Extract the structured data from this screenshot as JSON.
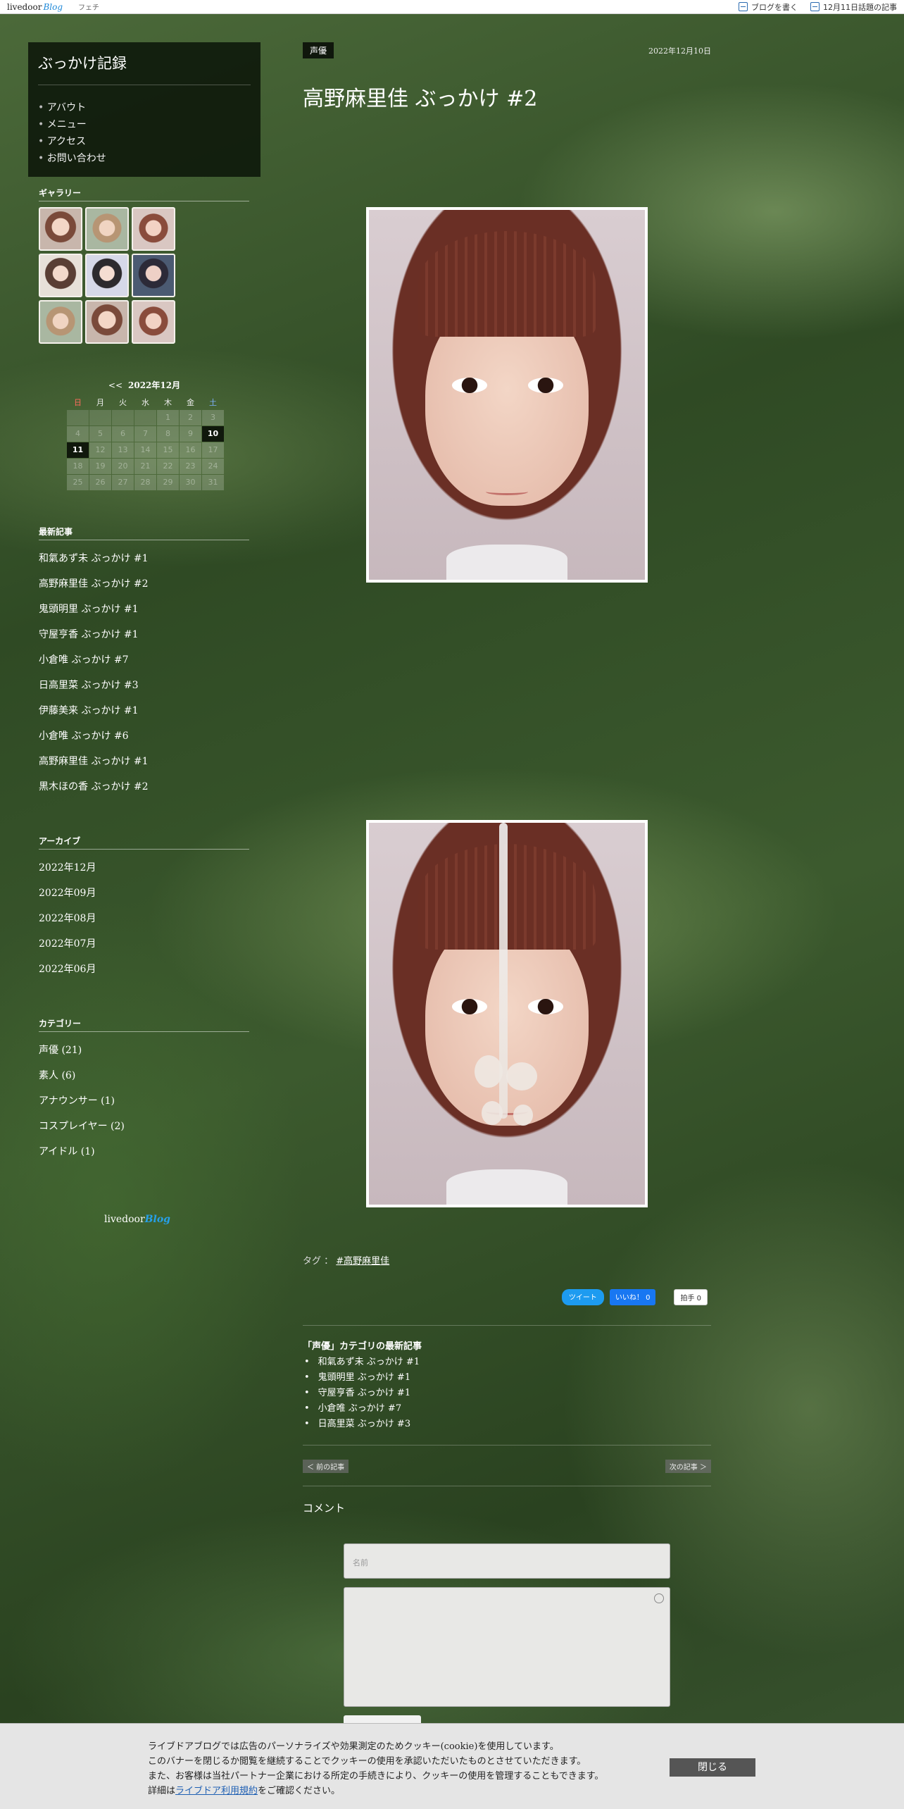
{
  "topbar": {
    "logo_main": "livedoor",
    "logo_blog": "Blog",
    "tag": "フェチ",
    "write_blog": "ブログを書く",
    "trending": "12月11日話題の記事"
  },
  "sidebar": {
    "blog_title": "ぶっかけ記録",
    "nav": [
      "アバウト",
      "メニュー",
      "アクセス",
      "お問い合わせ"
    ],
    "gallery_heading": "ギャラリー",
    "calendar": {
      "prev": "<<",
      "title": "2022年12月",
      "weekdays": [
        "日",
        "月",
        "火",
        "水",
        "木",
        "金",
        "土"
      ],
      "leading_blanks": 4,
      "days": [
        1,
        2,
        3,
        4,
        5,
        6,
        7,
        8,
        9,
        10,
        11,
        12,
        13,
        14,
        15,
        16,
        17,
        18,
        19,
        20,
        21,
        22,
        23,
        24,
        25,
        26,
        27,
        28,
        29,
        30,
        31
      ],
      "today": 11,
      "post_days": [
        10
      ]
    },
    "recent_heading": "最新記事",
    "recent": [
      "和氣あず未 ぶっかけ #1",
      "高野麻里佳 ぶっかけ #2",
      "鬼頭明里 ぶっかけ #1",
      "守屋亨香 ぶっかけ #1",
      "小倉唯 ぶっかけ #7",
      "日高里菜 ぶっかけ #3",
      "伊藤美来 ぶっかけ #1",
      "小倉唯 ぶっかけ #6",
      "高野麻里佳 ぶっかけ #1",
      "黒木ほの香 ぶっかけ #2"
    ],
    "archive_heading": "アーカイブ",
    "archives": [
      "2022年12月",
      "2022年09月",
      "2022年08月",
      "2022年07月",
      "2022年06月"
    ],
    "category_heading": "カテゴリー",
    "categories": [
      "声優 (21)",
      "素人 (6)",
      "アナウンサー (1)",
      "コスプレイヤー (2)",
      "アイドル (1)"
    ],
    "footer_logo_main": "livedoor",
    "footer_logo_blog": "Blog"
  },
  "post": {
    "category": "声優",
    "date": "2022年12月10日",
    "title": "高野麻里佳 ぶっかけ #2",
    "tags_label": "タグ ：",
    "tag": "#高野麻里佳",
    "tweet": "ツイート",
    "like": "いいね！ 0",
    "clap": "拍手 0",
    "cat_recent_heading": "「声優」カテゴリの最新記事",
    "cat_recent": [
      "和氣あず未 ぶっかけ #1",
      "鬼頭明里 ぶっかけ #1",
      "守屋亨香 ぶっかけ #1",
      "小倉唯 ぶっかけ #7",
      "日高里菜 ぶっかけ #3"
    ],
    "prev": "＜ 前の記事",
    "next": "次の記事 ＞",
    "comment_heading": "コメント",
    "name_placeholder": "名前"
  },
  "cookie": {
    "line1": "ライブドアブログでは広告のパーソナライズや効果測定のためクッキー(cookie)を使用しています。",
    "line2": "このバナーを閉じるか閲覧を継続することでクッキーの使用を承認いただいたものとさせていただきます。",
    "line3": "また、お客様は当社パートナー企業における所定の手続きにより、クッキーの使用を管理することもできます。",
    "line4_pre": "詳細は",
    "line4_link": "ライブドア利用規約",
    "line4_post": "をご確認ください。",
    "close": "閉じる"
  }
}
